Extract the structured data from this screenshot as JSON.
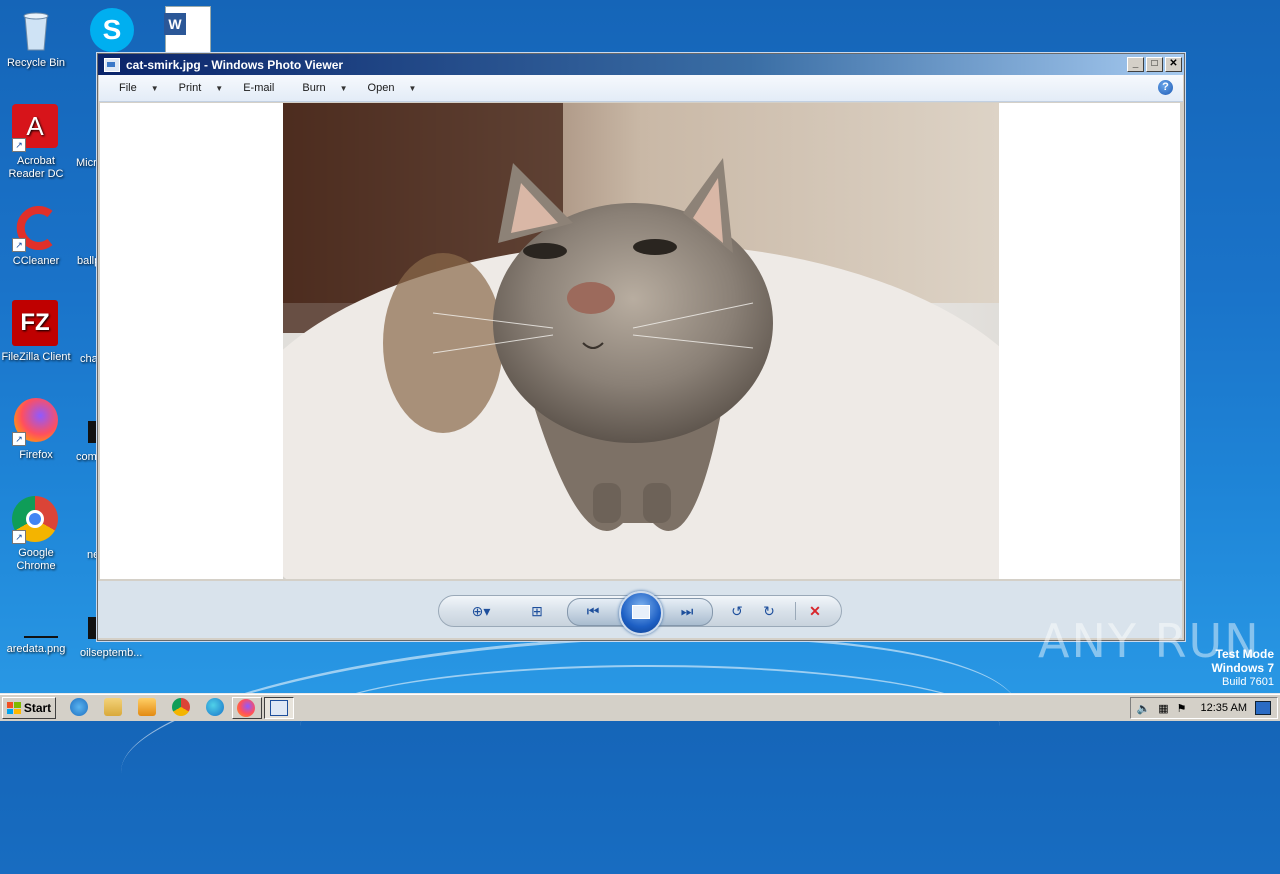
{
  "desktop": {
    "icons": [
      {
        "label": "Recycle Bin",
        "icon": "recycle-bin-icon"
      },
      {
        "label": "Acrobat Reader DC",
        "icon": "acrobat-icon"
      },
      {
        "label": "CCleaner",
        "icon": "ccleaner-icon"
      },
      {
        "label": "FileZilla Client",
        "icon": "filezilla-icon"
      },
      {
        "label": "Firefox",
        "icon": "firefox-icon"
      },
      {
        "label": "Google Chrome",
        "icon": "chrome-icon"
      },
      {
        "label": "aredata.png",
        "icon": "image-file-icon"
      }
    ],
    "partial_icons": [
      {
        "label": "Micr",
        "icon": "partial-icon"
      },
      {
        "label": "ballp",
        "icon": "partial-icon"
      },
      {
        "label": "cha",
        "icon": "partial-icon"
      },
      {
        "label": "com",
        "icon": "partial-icon"
      },
      {
        "label": "ne",
        "icon": "partial-icon"
      },
      {
        "label": "oilseptemb...",
        "icon": "partial-icon"
      }
    ],
    "top_icons": [
      {
        "icon": "skype-icon",
        "label": ""
      },
      {
        "icon": "word-document-icon",
        "label": ""
      }
    ]
  },
  "window": {
    "title": "cat-smirk.jpg - Windows Photo Viewer",
    "controls": {
      "minimize": "_",
      "maximize": "□",
      "close": "✕"
    },
    "menu": [
      {
        "label": "File",
        "has_dropdown": true
      },
      {
        "label": "Print",
        "has_dropdown": true
      },
      {
        "label": "E-mail",
        "has_dropdown": false
      },
      {
        "label": "Burn",
        "has_dropdown": true
      },
      {
        "label": "Open",
        "has_dropdown": true
      }
    ],
    "help_label": "?",
    "image_subject": "cat photo"
  },
  "playback_controls": [
    {
      "name": "zoom-button",
      "icon": "zoom-icon"
    },
    {
      "name": "actual-size-button",
      "icon": "fit-window-icon"
    },
    {
      "name": "previous-button",
      "icon": "previous-icon"
    },
    {
      "name": "slideshow-button",
      "icon": "slideshow-icon"
    },
    {
      "name": "next-button",
      "icon": "next-icon"
    },
    {
      "name": "rotate-ccw-button",
      "icon": "rotate-counterclockwise-icon"
    },
    {
      "name": "rotate-cw-button",
      "icon": "rotate-clockwise-icon"
    },
    {
      "name": "delete-button",
      "icon": "delete-icon"
    }
  ],
  "watermark": {
    "text": "ANY RUN"
  },
  "system_info": {
    "line1": "Test Mode",
    "line2": "Windows 7",
    "line3": "Build 7601"
  },
  "taskbar": {
    "start_label": "Start",
    "clock": "12:35 AM"
  },
  "colors": {
    "accent": "#1e4f9c",
    "delete": "#d8262b",
    "titlebar": "#0a246a"
  }
}
